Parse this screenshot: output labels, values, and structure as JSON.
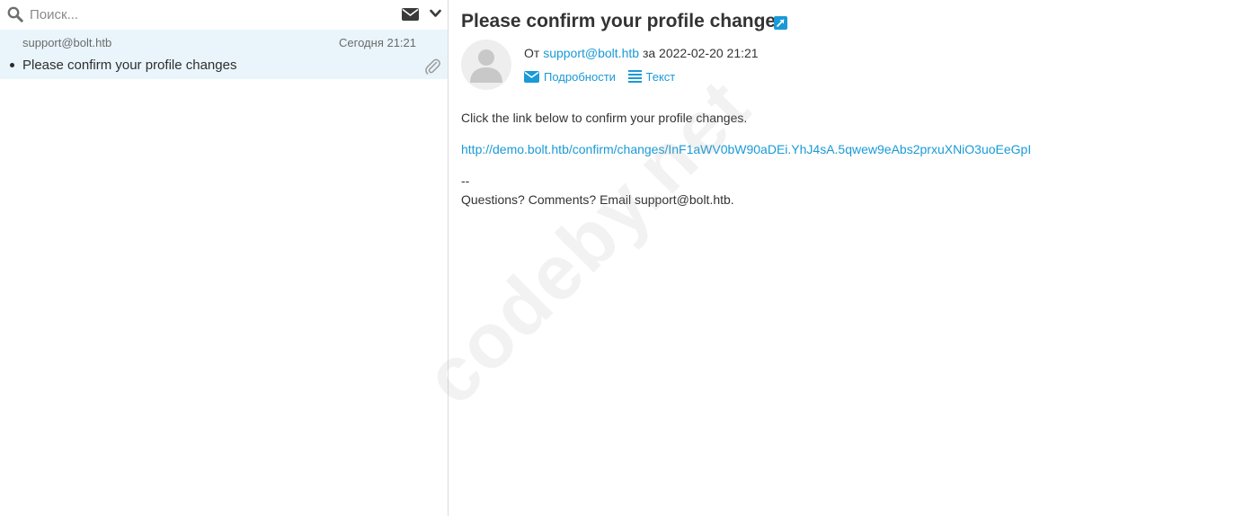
{
  "search": {
    "placeholder": "Поиск..."
  },
  "message_list": [
    {
      "from": "support@bolt.htb",
      "date": "Сегодня 21:21",
      "subject": "Please confirm your profile changes"
    }
  ],
  "message_view": {
    "subject": "Please confirm your profile changes",
    "from_prefix": "От",
    "from_address": "support@bolt.htb",
    "date_prefix": "за",
    "date": "2022-02-20 21:21",
    "actions": {
      "details_label": "Подробности",
      "text_label": "Текст"
    },
    "body": {
      "line1": "Click the link below to confirm your profile changes.",
      "link": "http://demo.bolt.htb/confirm/changes/InF1aWV0bW90aDEi.YhJ4sA.5qwew9eAbs2prxuXNiO3uoEeGpI",
      "separator": "--",
      "signature": "Questions? Comments? Email support@bolt.htb."
    }
  },
  "watermark": "codeby.net",
  "colors": {
    "accent": "#1a9ad6",
    "selected_row": "#e9f5fb"
  }
}
